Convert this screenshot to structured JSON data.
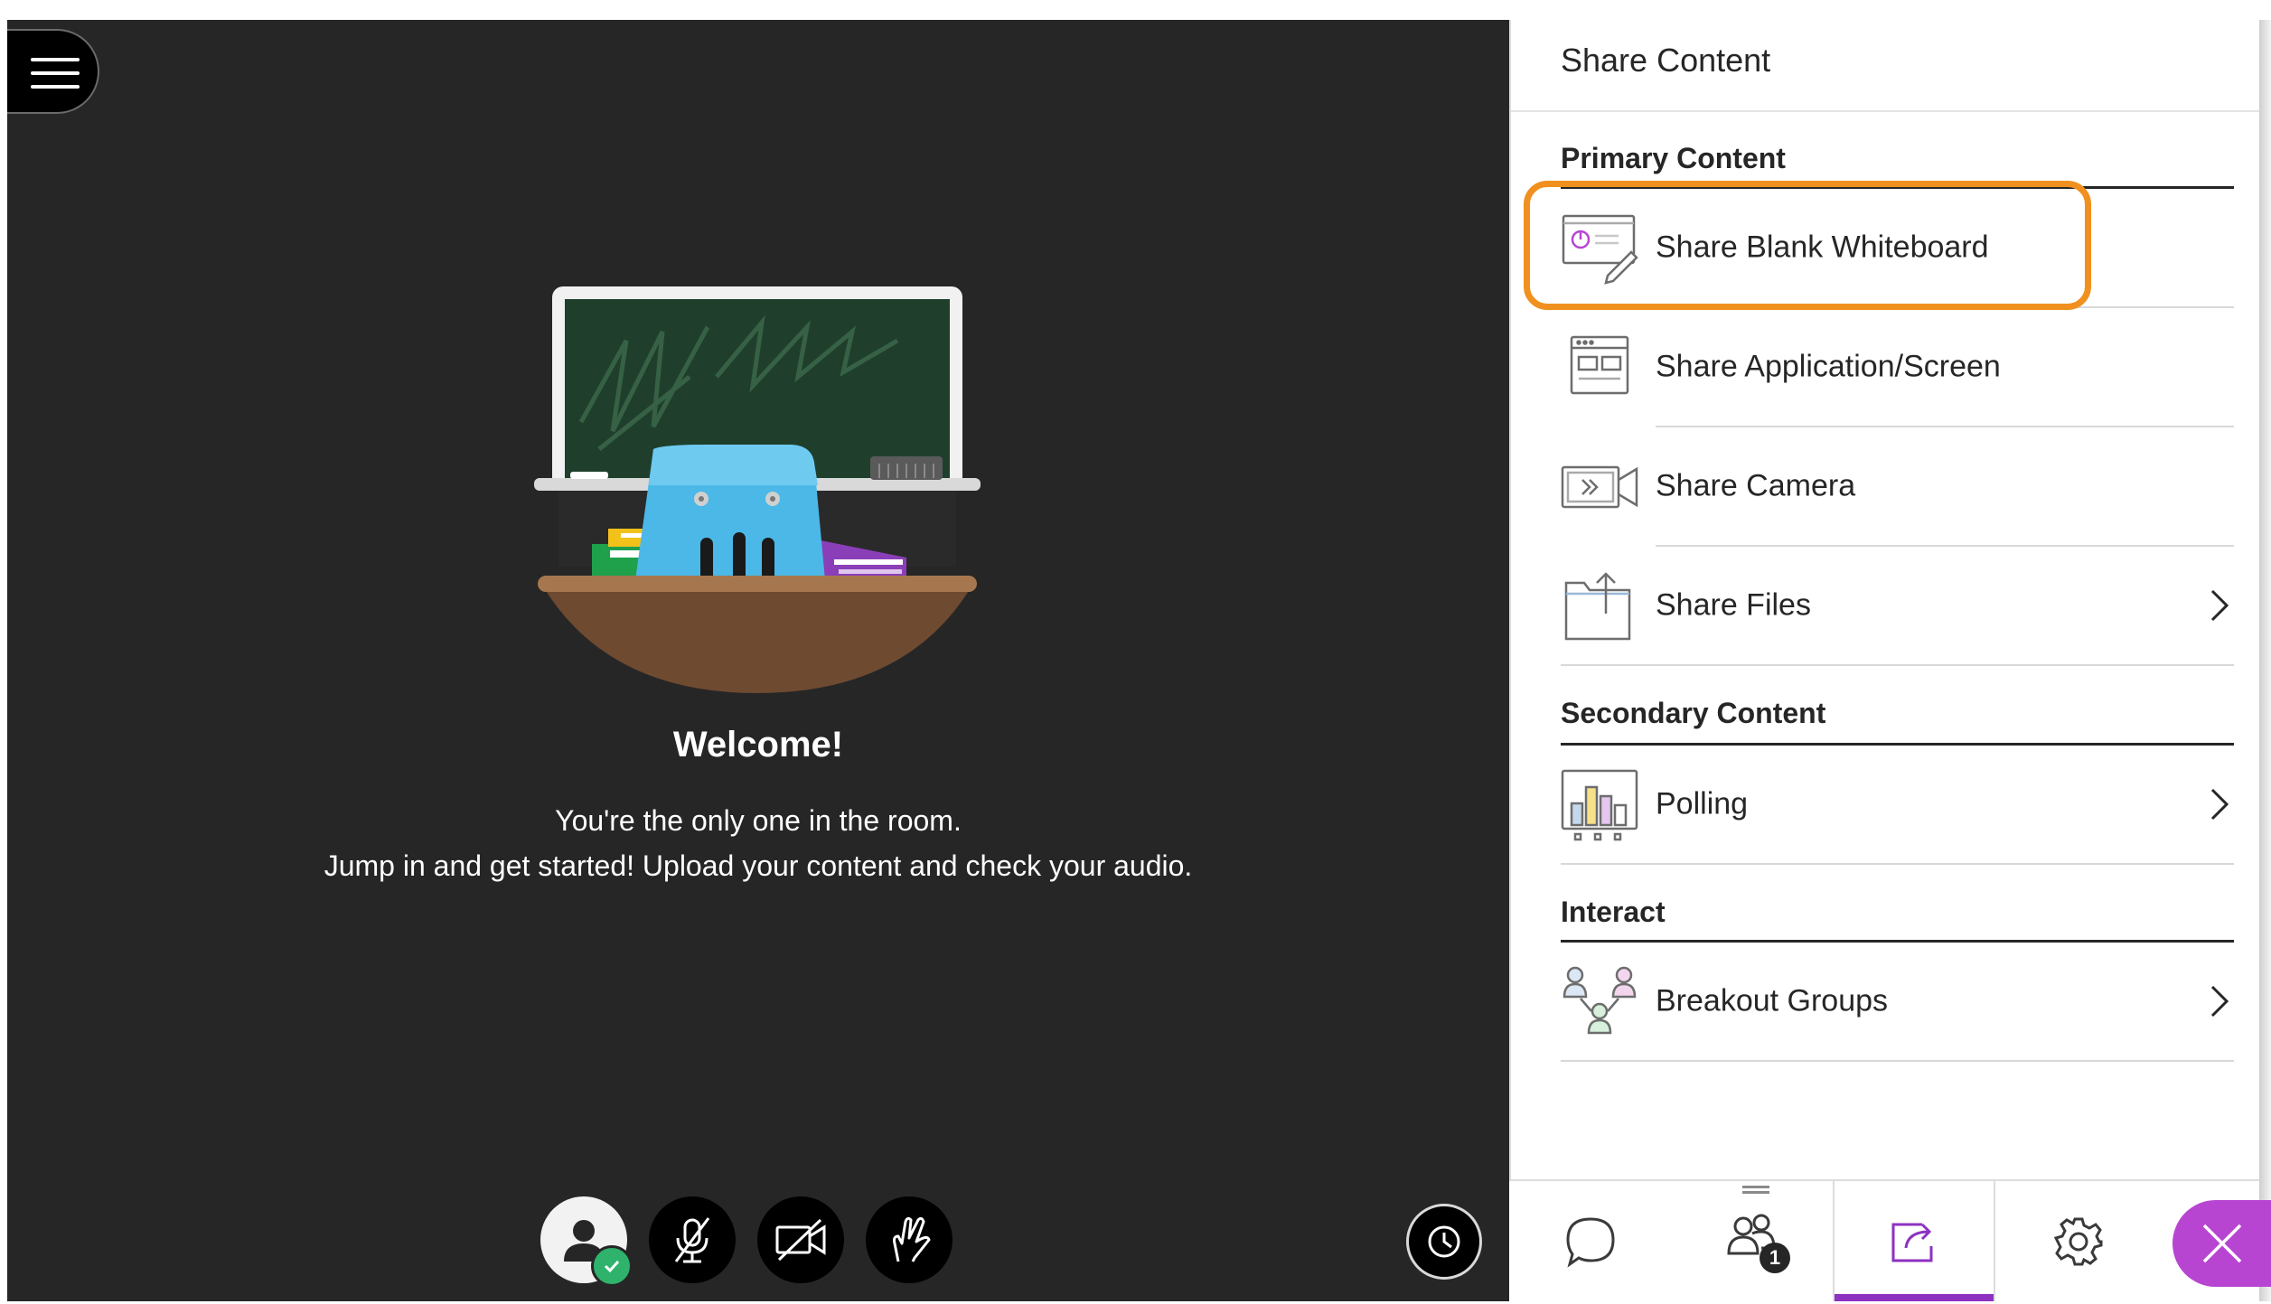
{
  "stage": {
    "welcome_title": "Welcome!",
    "welcome_line1": "You're the only one in the room.",
    "welcome_line2": "Jump in and get started! Upload your content and check your audio.",
    "controls": {
      "avatar": "avatar-icon",
      "microphone": "microphone-muted-icon",
      "camera": "camera-off-icon",
      "hand": "raise-hand-icon",
      "timer": "timer-icon"
    }
  },
  "panel": {
    "title": "Share Content",
    "sections": {
      "primary": {
        "label": "Primary Content",
        "items": [
          {
            "label": "Share Blank Whiteboard",
            "icon": "whiteboard-icon"
          },
          {
            "label": "Share Application/Screen",
            "icon": "screen-share-icon"
          },
          {
            "label": "Share Camera",
            "icon": "camera-share-icon"
          },
          {
            "label": "Share Files",
            "icon": "file-share-icon"
          }
        ]
      },
      "secondary": {
        "label": "Secondary Content",
        "items": [
          {
            "label": "Polling",
            "icon": "polling-icon"
          }
        ]
      },
      "interact": {
        "label": "Interact",
        "items": [
          {
            "label": "Breakout Groups",
            "icon": "breakout-groups-icon"
          }
        ]
      }
    }
  },
  "tabbar": {
    "attendee_count": "1",
    "active_tab": "share-content",
    "tabs": [
      "chat-icon",
      "attendees-icon",
      "share-content-icon",
      "settings-icon"
    ]
  },
  "colors": {
    "stage_bg": "#262626",
    "highlight": "#f0901e",
    "accent": "#8e32c2",
    "close": "#b845d2",
    "online": "#2fb36c"
  }
}
